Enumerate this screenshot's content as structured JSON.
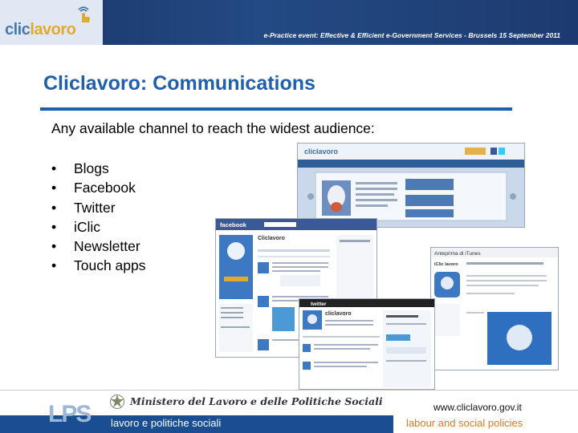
{
  "header": {
    "logo_clic": "clic",
    "logo_lavoro": "lavoro",
    "event": "e-Practice event:  Effective & Efficient e-Government Services -  Brussels 15 September 2011"
  },
  "slide": {
    "title": "Cliclavoro: Communications",
    "lead": "Any available channel to reach the widest audience:",
    "bullets": [
      "Blogs",
      "Facebook",
      "Twitter",
      "iClic",
      "Newsletter",
      "Touch apps"
    ],
    "bullet_glyph": "•"
  },
  "screens": {
    "fb_logo": "facebook",
    "fb_page": "Cliclavoro",
    "tw_logo": "twitter",
    "tw_name": "cliclavoro",
    "itunes_title": "Anteprima di iTunes",
    "itunes_app": "iClic lavoro"
  },
  "footer": {
    "lps": "LPS",
    "ministero": "Ministero del Lavoro e delle Politiche Sociali",
    "lavoro_politiche": "lavoro e politiche sociali",
    "website": "www.cliclavoro.gov.it",
    "labour": "labour and social policies"
  },
  "colors": {
    "title_blue": "#1f5fae",
    "header_navy": "#1f3b6e",
    "labour_orange": "#e07a1f"
  }
}
